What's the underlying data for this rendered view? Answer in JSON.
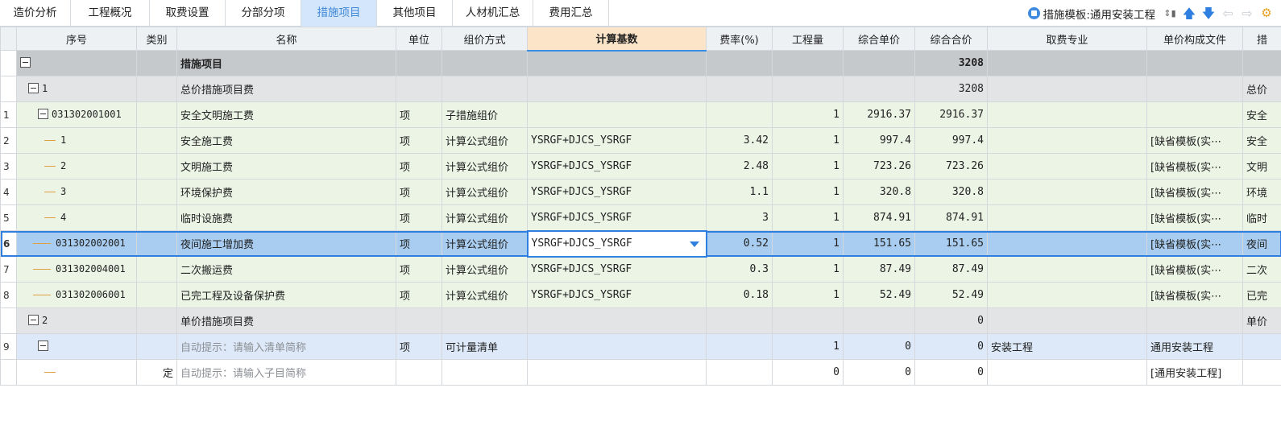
{
  "tabs": [
    {
      "label": "造价分析",
      "active": false
    },
    {
      "label": "工程概况",
      "active": false
    },
    {
      "label": "取费设置",
      "active": false
    },
    {
      "label": "分部分项",
      "active": false
    },
    {
      "label": "措施项目",
      "active": true
    },
    {
      "label": "其他项目",
      "active": false
    },
    {
      "label": "人材机汇总",
      "active": false
    },
    {
      "label": "费用汇总",
      "active": false
    }
  ],
  "toolbar": {
    "template_label": "措施模板:通用安装工程",
    "icons": [
      "template-icon",
      "sort-icon",
      "move-up-icon",
      "move-down-icon",
      "arrow-left-icon",
      "arrow-right-icon",
      "settings-icon"
    ]
  },
  "columns": [
    "序号",
    "类别",
    "名称",
    "单位",
    "组价方式",
    "计算基数",
    "费率(%)",
    "工程量",
    "综合单价",
    "综合合价",
    "取费专业",
    "单价构成文件",
    "措"
  ],
  "rows": [
    {
      "idx": "",
      "seq": "",
      "cat": "",
      "name": "措施项目",
      "unit": "",
      "method": "",
      "base": "",
      "rate": "",
      "qty": "",
      "price": "",
      "total": "3208",
      "major": "",
      "file": "",
      "extra": ""
    },
    {
      "idx": "",
      "seq": "1",
      "cat": "",
      "name": "总价措施项目费",
      "unit": "",
      "method": "",
      "base": "",
      "rate": "",
      "qty": "",
      "price": "",
      "total": "3208",
      "major": "",
      "file": "",
      "extra": "总价"
    },
    {
      "idx": "1",
      "seq": "031302001001",
      "cat": "",
      "name": "安全文明施工费",
      "unit": "项",
      "method": "子措施组价",
      "base": "",
      "rate": "",
      "qty": "1",
      "price": "2916.37",
      "total": "2916.37",
      "major": "",
      "file": "",
      "extra": "安全"
    },
    {
      "idx": "2",
      "seq": "1",
      "cat": "",
      "name": "安全施工费",
      "unit": "项",
      "method": "计算公式组价",
      "base": "YSRGF+DJCS_YSRGF",
      "rate": "3.42",
      "qty": "1",
      "price": "997.4",
      "total": "997.4",
      "major": "",
      "file": "[缺省模板(实⋯",
      "extra": "安全"
    },
    {
      "idx": "3",
      "seq": "2",
      "cat": "",
      "name": "文明施工费",
      "unit": "项",
      "method": "计算公式组价",
      "base": "YSRGF+DJCS_YSRGF",
      "rate": "2.48",
      "qty": "1",
      "price": "723.26",
      "total": "723.26",
      "major": "",
      "file": "[缺省模板(实⋯",
      "extra": "文明"
    },
    {
      "idx": "4",
      "seq": "3",
      "cat": "",
      "name": "环境保护费",
      "unit": "项",
      "method": "计算公式组价",
      "base": "YSRGF+DJCS_YSRGF",
      "rate": "1.1",
      "qty": "1",
      "price": "320.8",
      "total": "320.8",
      "major": "",
      "file": "[缺省模板(实⋯",
      "extra": "环境"
    },
    {
      "idx": "5",
      "seq": "4",
      "cat": "",
      "name": "临时设施费",
      "unit": "项",
      "method": "计算公式组价",
      "base": "YSRGF+DJCS_YSRGF",
      "rate": "3",
      "qty": "1",
      "price": "874.91",
      "total": "874.91",
      "major": "",
      "file": "[缺省模板(实⋯",
      "extra": "临时"
    },
    {
      "idx": "6",
      "seq": "031302002001",
      "cat": "",
      "name": "夜间施工增加费",
      "unit": "项",
      "method": "计算公式组价",
      "base": "YSRGF+DJCS_YSRGF",
      "rate": "0.52",
      "qty": "1",
      "price": "151.65",
      "total": "151.65",
      "major": "",
      "file": "[缺省模板(实⋯",
      "extra": "夜间"
    },
    {
      "idx": "7",
      "seq": "031302004001",
      "cat": "",
      "name": "二次搬运费",
      "unit": "项",
      "method": "计算公式组价",
      "base": "YSRGF+DJCS_YSRGF",
      "rate": "0.3",
      "qty": "1",
      "price": "87.49",
      "total": "87.49",
      "major": "",
      "file": "[缺省模板(实⋯",
      "extra": "二次"
    },
    {
      "idx": "8",
      "seq": "031302006001",
      "cat": "",
      "name": "已完工程及设备保护费",
      "unit": "项",
      "method": "计算公式组价",
      "base": "YSRGF+DJCS_YSRGF",
      "rate": "0.18",
      "qty": "1",
      "price": "52.49",
      "total": "52.49",
      "major": "",
      "file": "[缺省模板(实⋯",
      "extra": "已完"
    },
    {
      "idx": "",
      "seq": "2",
      "cat": "",
      "name": "单价措施项目费",
      "unit": "",
      "method": "",
      "base": "",
      "rate": "",
      "qty": "",
      "price": "",
      "total": "0",
      "major": "",
      "file": "",
      "extra": "单价"
    },
    {
      "idx": "9",
      "seq": "",
      "cat": "",
      "name": "自动提示：请输入清单简称",
      "unit": "项",
      "method": "可计量清单",
      "base": "",
      "rate": "",
      "qty": "1",
      "price": "0",
      "total": "0",
      "major": "安装工程",
      "file": "通用安装工程",
      "extra": ""
    },
    {
      "idx": "",
      "seq": "",
      "cat": "定",
      "name": "自动提示：请输入子目简称",
      "unit": "",
      "method": "",
      "base": "",
      "rate": "",
      "qty": "0",
      "price": "0",
      "total": "0",
      "major": "",
      "file": "[通用安装工程]",
      "extra": ""
    }
  ]
}
